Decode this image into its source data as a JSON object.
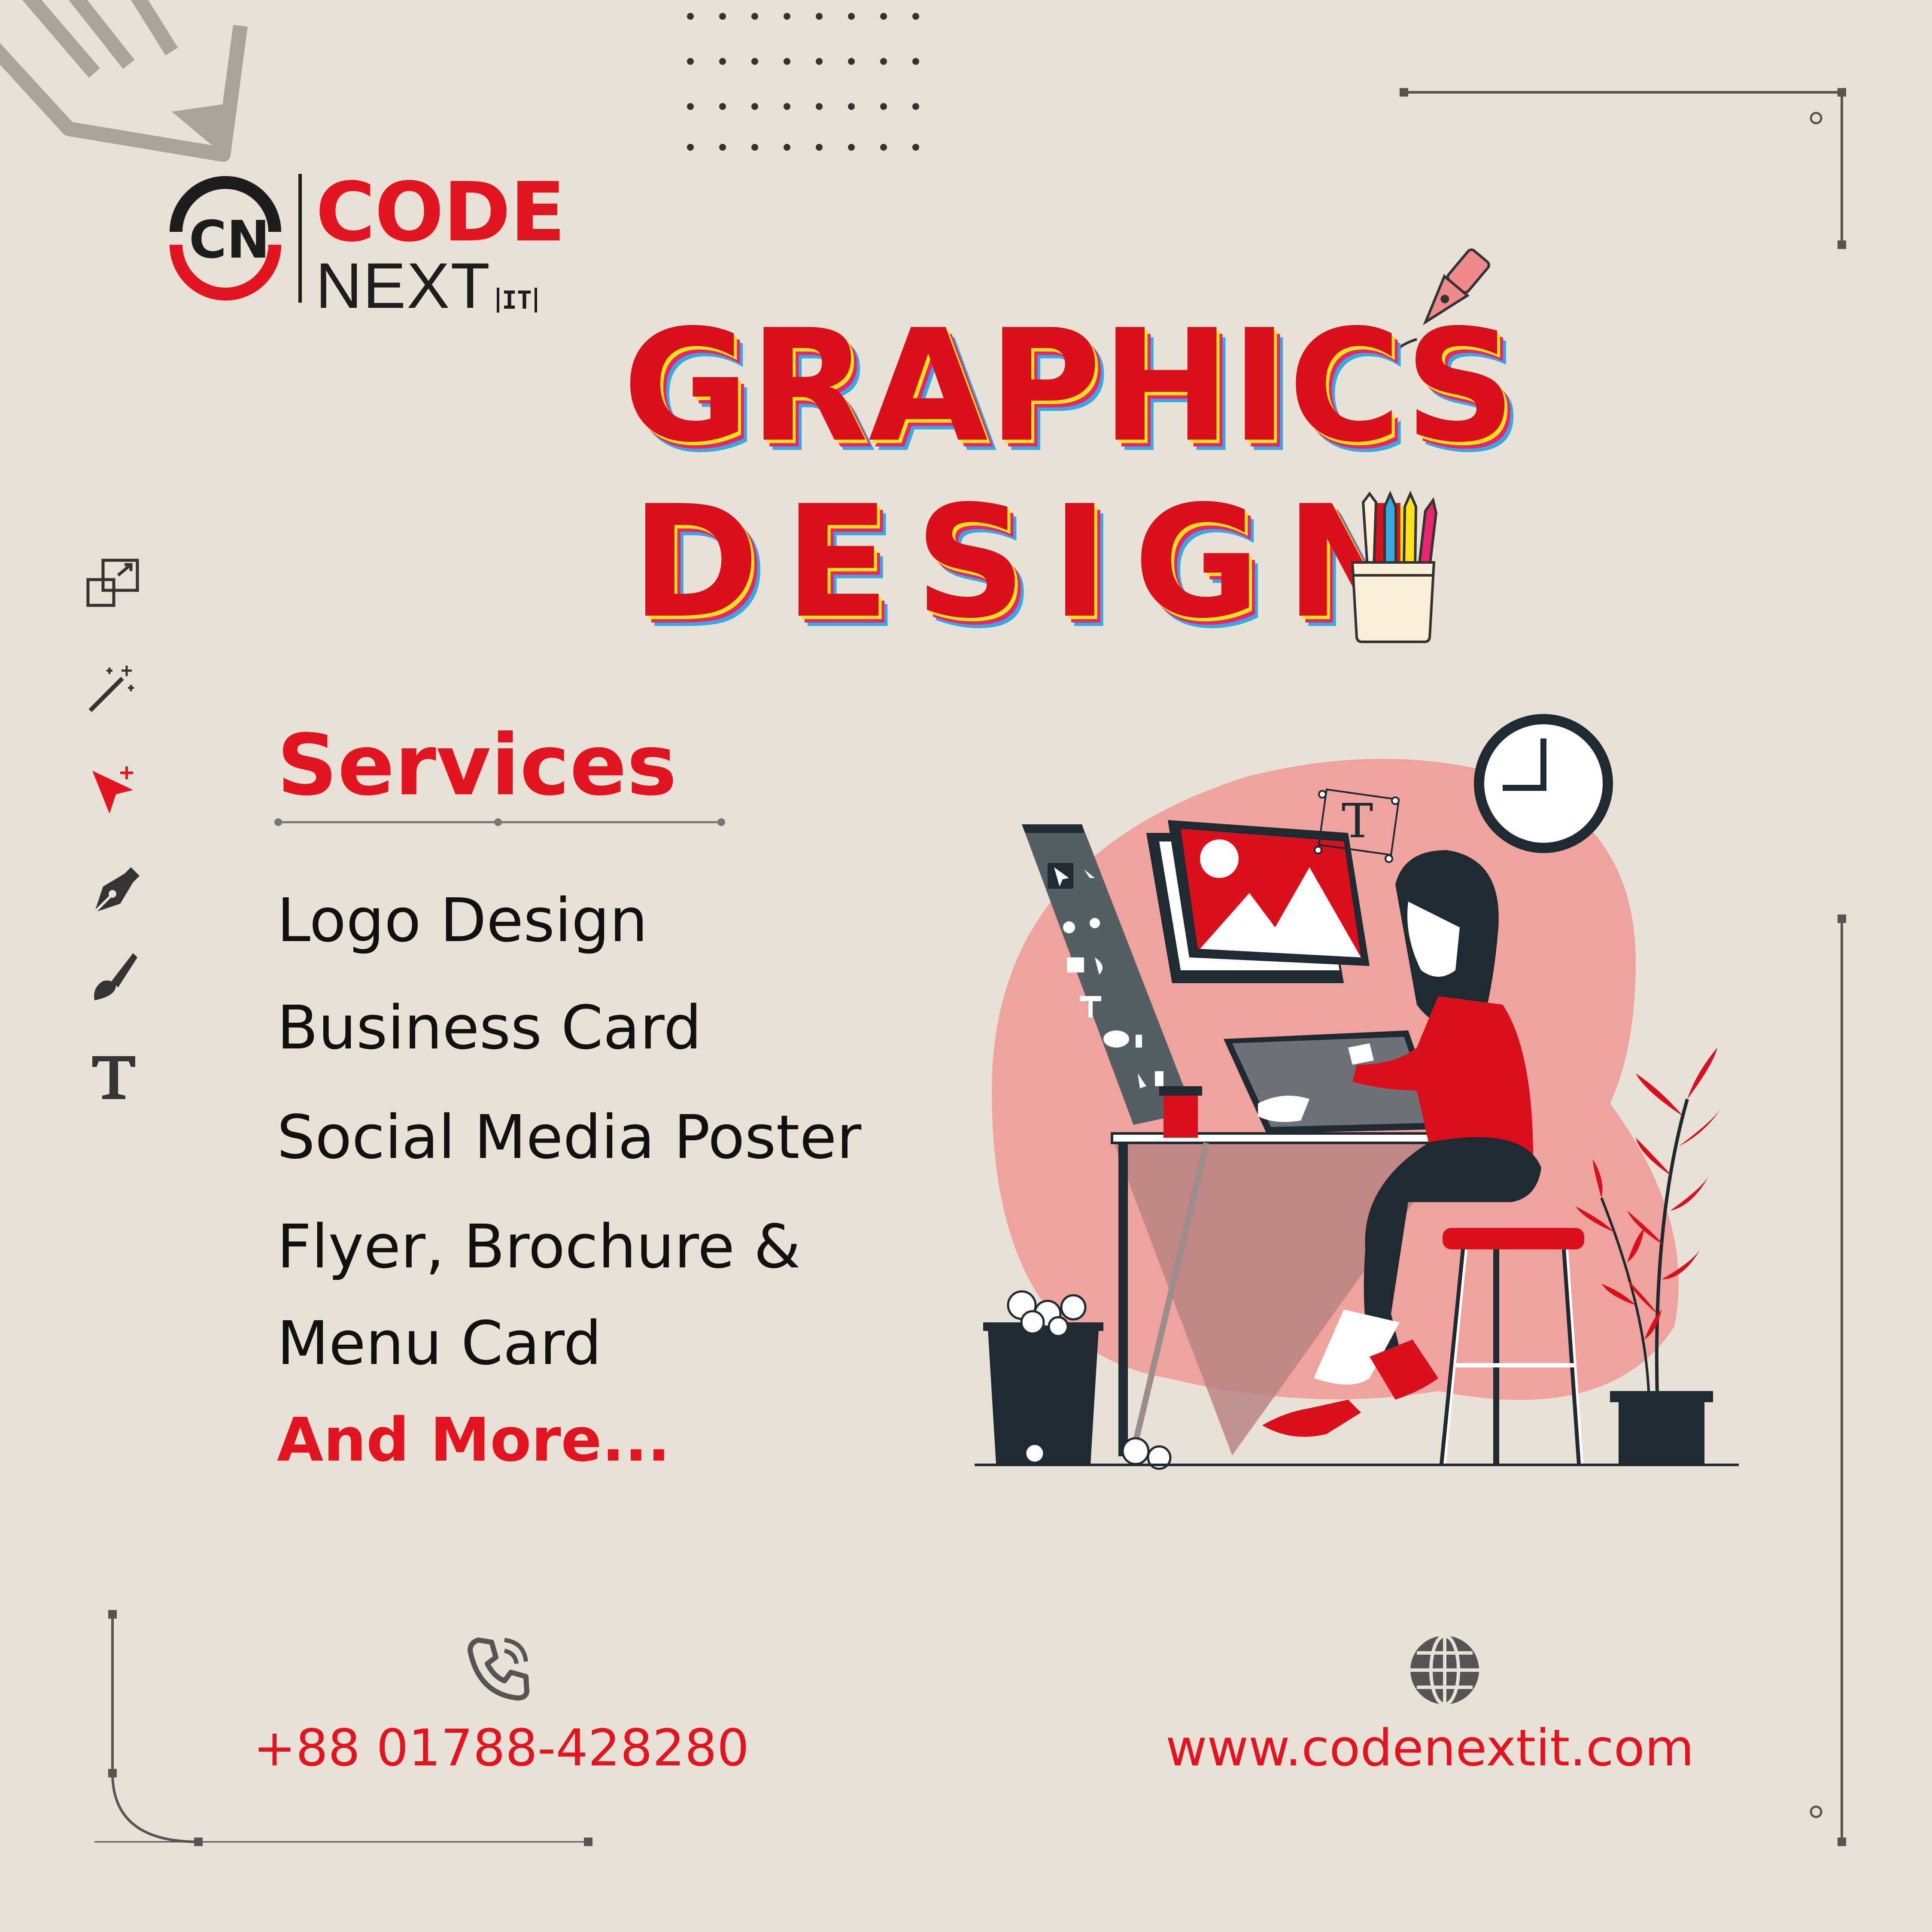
{
  "brand": {
    "name_top": "CODE",
    "name_bottom": "NEXT",
    "name_suffix": "IT",
    "monogram": "CN"
  },
  "headline": {
    "line1": "GRAPHICS",
    "line2": "DESIGN"
  },
  "services": {
    "title": "Services",
    "items": [
      "Logo Design",
      "Business Card",
      "Social Media Poster",
      "Flyer, Brochure &",
      "Menu Card"
    ],
    "more": "And More..."
  },
  "contact": {
    "phone": "+88 01788-428280",
    "website": "www.codenextit.com"
  },
  "tool_icons": [
    "resize-icon",
    "magic-wand-icon",
    "cursor-add-icon",
    "pen-tool-icon",
    "brush-icon",
    "text-tool-icon"
  ],
  "colors": {
    "background": "#e8e2d6",
    "brand_red": "#e3141f",
    "dark": "#1f2a30",
    "blob_pink": "#eea39f",
    "shadow_yellow": "#ffe21a",
    "shadow_pink": "#e8256a",
    "shadow_blue": "#36a9e0"
  }
}
